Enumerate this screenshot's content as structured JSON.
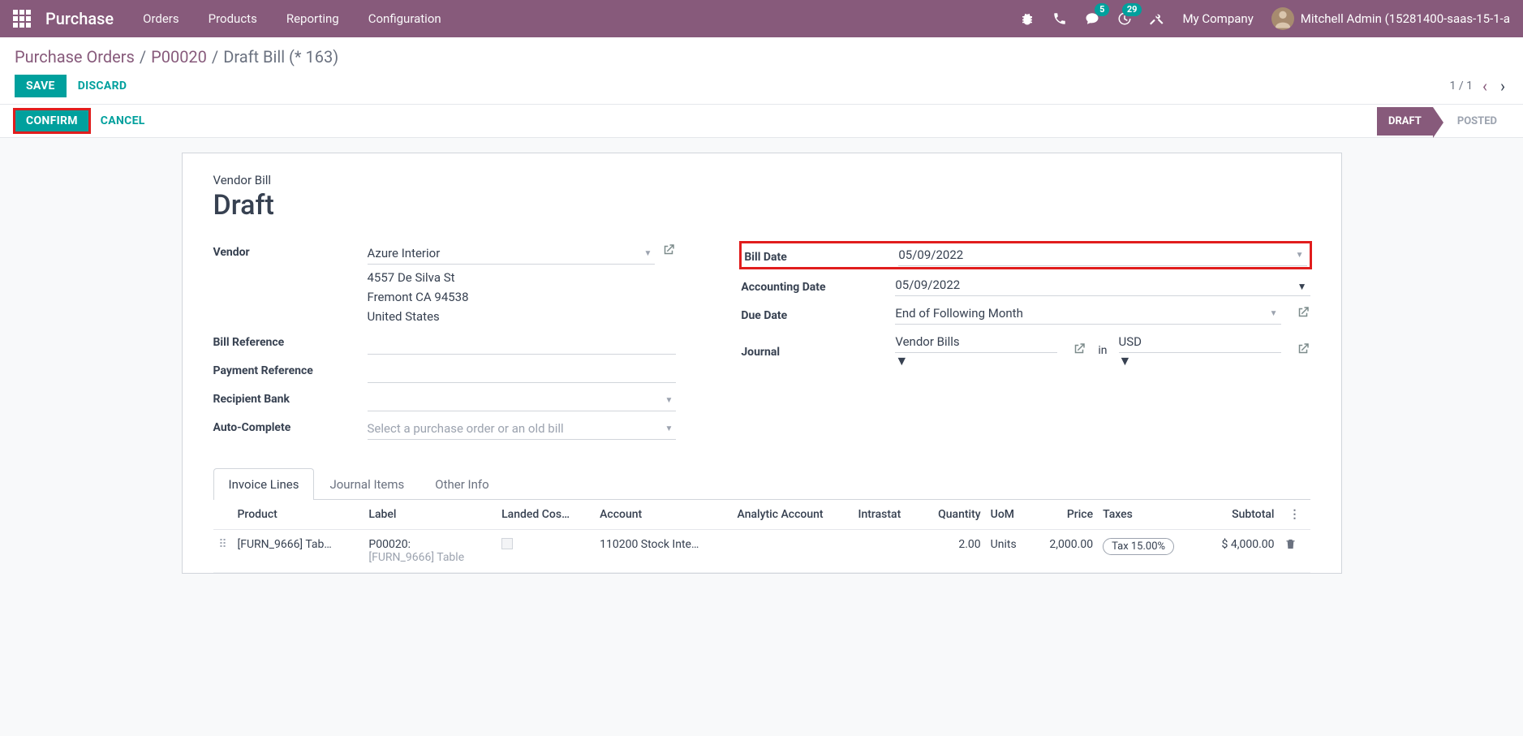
{
  "nav": {
    "app": "Purchase",
    "menus": [
      "Orders",
      "Products",
      "Reporting",
      "Configuration"
    ],
    "badge_chat": "5",
    "badge_activity": "29",
    "company": "My Company",
    "user": "Mitchell Admin (15281400-saas-15-1-a"
  },
  "breadcrumb": {
    "a": "Purchase Orders",
    "b": "P00020",
    "c": "Draft Bill (* 163)"
  },
  "actions": {
    "save": "SAVE",
    "discard": "DISCARD"
  },
  "pager": "1 / 1",
  "statusbar": {
    "confirm": "CONFIRM",
    "cancel": "CANCEL",
    "draft": "DRAFT",
    "posted": "POSTED"
  },
  "header": {
    "type": "Vendor Bill",
    "title": "Draft"
  },
  "left": {
    "vendor_lbl": "Vendor",
    "vendor": "Azure Interior",
    "addr1": "4557 De Silva St",
    "addr2": "Fremont CA 94538",
    "addr3": "United States",
    "billref_lbl": "Bill Reference",
    "payref_lbl": "Payment Reference",
    "bank_lbl": "Recipient Bank",
    "auto_lbl": "Auto-Complete",
    "auto_ph": "Select a purchase order or an old bill"
  },
  "right": {
    "billdate_lbl": "Bill Date",
    "billdate": "05/09/2022",
    "accdate_lbl": "Accounting Date",
    "accdate": "05/09/2022",
    "duedate_lbl": "Due Date",
    "duedate": "End of Following Month",
    "journal_lbl": "Journal",
    "journal": "Vendor Bills",
    "in": "in",
    "currency": "USD"
  },
  "tabs": {
    "t1": "Invoice Lines",
    "t2": "Journal Items",
    "t3": "Other Info"
  },
  "cols": {
    "product": "Product",
    "label": "Label",
    "landed": "Landed Cos…",
    "account": "Account",
    "analytic": "Analytic Account",
    "intrastat": "Intrastat",
    "qty": "Quantity",
    "uom": "UoM",
    "price": "Price",
    "taxes": "Taxes",
    "subtotal": "Subtotal"
  },
  "line": {
    "product": "[FURN_9666] Tab…",
    "label_a": "P00020:",
    "label_b": "[FURN_9666] Table",
    "account": "110200 Stock Inte…",
    "qty": "2.00",
    "uom": "Units",
    "price": "2,000.00",
    "tax": "Tax 15.00%",
    "subtotal": "$ 4,000.00"
  }
}
